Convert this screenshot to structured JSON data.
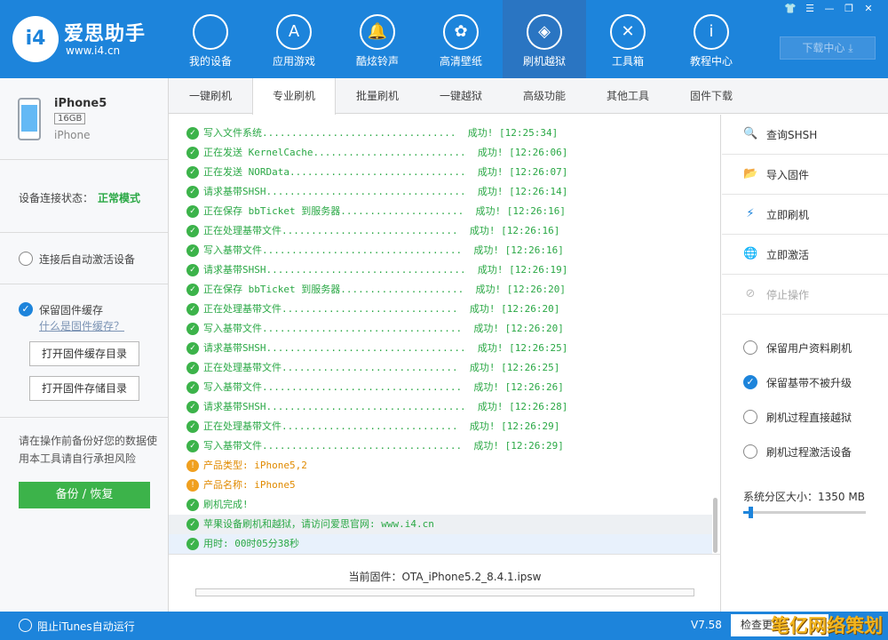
{
  "app": {
    "logo_mark": "i4",
    "name": "爱思助手",
    "url": "www.i4.cn",
    "brand_color": "#1d84db"
  },
  "nav": [
    {
      "label": "我的设备",
      "icon": "apple-icon"
    },
    {
      "label": "应用游戏",
      "icon": "appstore-icon"
    },
    {
      "label": "酷炫铃声",
      "icon": "bell-icon"
    },
    {
      "label": "高清壁纸",
      "icon": "flower-icon"
    },
    {
      "label": "刷机越狱",
      "icon": "dropbox-icon"
    },
    {
      "label": "工具箱",
      "icon": "tools-icon"
    },
    {
      "label": "教程中心",
      "icon": "info-icon"
    }
  ],
  "download_center": "下载中心",
  "device": {
    "name": "iPhone5",
    "capacity": "16GB",
    "type": "iPhone"
  },
  "connection": {
    "label": "设备连接状态：",
    "value": "正常模式",
    "value_color": "#2aa845"
  },
  "auto_activate": "连接后自动激活设备",
  "firmware_cache": {
    "label": "保留固件缓存",
    "link": "什么是固件缓存？",
    "open_cache_btn": "打开固件缓存目录",
    "open_store_btn": "打开固件存储目录"
  },
  "warning": "请在操作前备份好您的数据使用本工具请自行承担风险",
  "backup_btn": "备份 / 恢复",
  "tabs": [
    "一键刷机",
    "专业刷机",
    "批量刷机",
    "一键越狱",
    "高级功能",
    "其他工具",
    "固件下载"
  ],
  "active_tab": "专业刷机",
  "log": [
    {
      "type": "ok",
      "text": "写入文件系统.................................  成功! [12:25:34]"
    },
    {
      "type": "ok",
      "text": "正在发送 KernelCache..........................  成功! [12:26:06]"
    },
    {
      "type": "ok",
      "text": "正在发送 NORData..............................  成功! [12:26:07]"
    },
    {
      "type": "ok",
      "text": "请求基带SHSH..................................  成功! [12:26:14]"
    },
    {
      "type": "ok",
      "text": "正在保存 bbTicket 到服务器.....................  成功! [12:26:16]"
    },
    {
      "type": "ok",
      "text": "正在处理基带文件..............................  成功! [12:26:16]"
    },
    {
      "type": "ok",
      "text": "写入基带文件..................................  成功! [12:26:16]"
    },
    {
      "type": "ok",
      "text": "请求基带SHSH..................................  成功! [12:26:19]"
    },
    {
      "type": "ok",
      "text": "正在保存 bbTicket 到服务器.....................  成功! [12:26:20]"
    },
    {
      "type": "ok",
      "text": "正在处理基带文件..............................  成功! [12:26:20]"
    },
    {
      "type": "ok",
      "text": "写入基带文件..................................  成功! [12:26:20]"
    },
    {
      "type": "ok",
      "text": "请求基带SHSH..................................  成功! [12:26:25]"
    },
    {
      "type": "ok",
      "text": "正在处理基带文件..............................  成功! [12:26:25]"
    },
    {
      "type": "ok",
      "text": "写入基带文件..................................  成功! [12:26:26]"
    },
    {
      "type": "ok",
      "text": "请求基带SHSH..................................  成功! [12:26:28]"
    },
    {
      "type": "ok",
      "text": "正在处理基带文件..............................  成功! [12:26:29]"
    },
    {
      "type": "ok",
      "text": "写入基带文件..................................  成功! [12:26:29]"
    },
    {
      "type": "warn",
      "text": "产品类型: iPhone5,2"
    },
    {
      "type": "warn",
      "text": "产品名称: iPhone5"
    },
    {
      "type": "ok",
      "text": "刷机完成!"
    },
    {
      "type": "ok",
      "text": "苹果设备刷机和越狱，请访问爱思官网: www.i4.cn"
    },
    {
      "type": "ok",
      "text": "用时: 00时05分38秒"
    }
  ],
  "current_firmware": "当前固件：OTA_iPhone5.2_8.4.1.ipsw",
  "actions": [
    {
      "label": "查询SHSH",
      "icon": "search-shsh-icon",
      "enabled": true
    },
    {
      "label": "导入固件",
      "icon": "import-folder-icon",
      "enabled": true
    },
    {
      "label": "立即刷机",
      "icon": "flash-icon",
      "enabled": true
    },
    {
      "label": "立即激活",
      "icon": "globe-icon",
      "enabled": true
    },
    {
      "label": "停止操作",
      "icon": "stop-icon",
      "enabled": false
    }
  ],
  "options": [
    {
      "label": "保留用户资料刷机",
      "checked": false
    },
    {
      "label": "保留基带不被升级",
      "checked": true
    },
    {
      "label": "刷机过程直接越狱",
      "checked": false
    },
    {
      "label": "刷机过程激活设备",
      "checked": false
    }
  ],
  "partition": {
    "label": "系统分区大小：1350 MB",
    "value_mb": 1350
  },
  "bottom": {
    "itunes": "阻止iTunes自动运行",
    "version": "V7.58",
    "check_update": "检查更新"
  },
  "watermark": "笔亿网络策划"
}
